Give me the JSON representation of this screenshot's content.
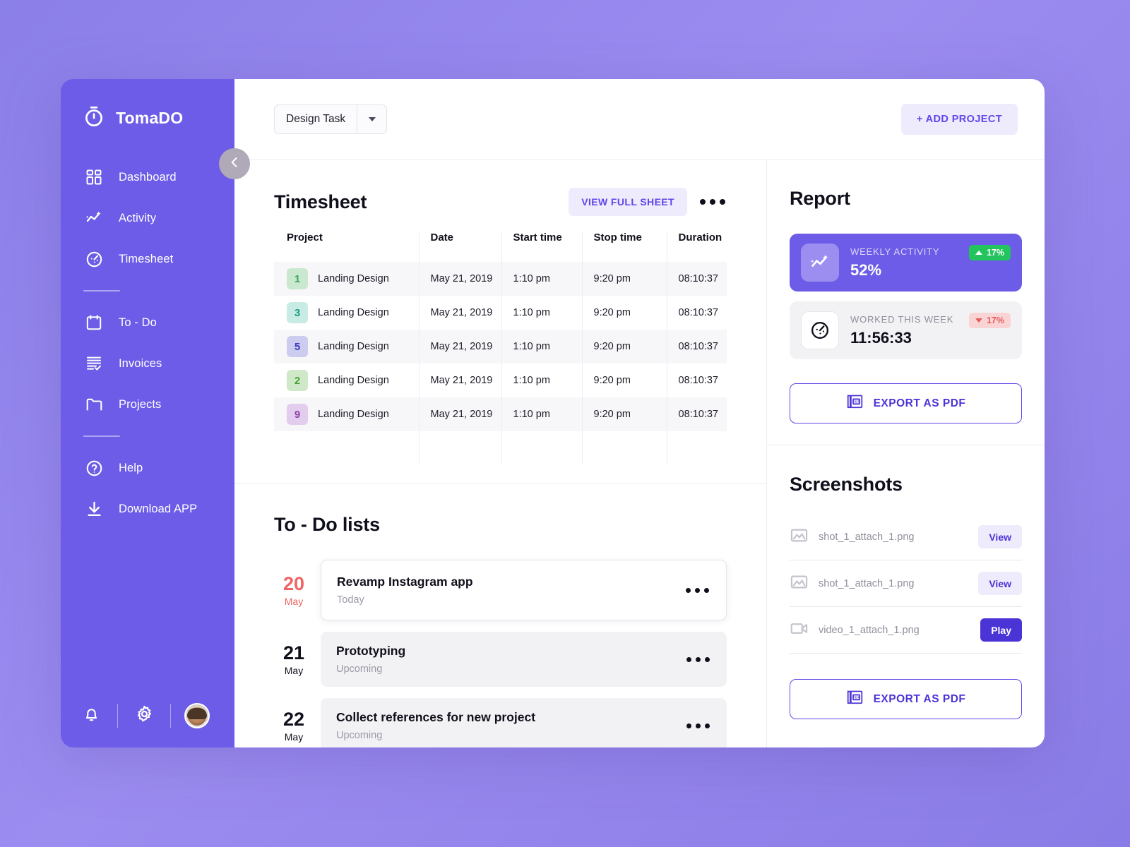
{
  "brand": {
    "name": "TomaDO",
    "logo_icon": "stopwatch-icon"
  },
  "sidebar": {
    "items": [
      {
        "label": "Dashboard",
        "icon": "grid-icon"
      },
      {
        "label": "Activity",
        "icon": "activity-sparkle-icon"
      },
      {
        "label": "Timesheet",
        "icon": "timer-icon"
      },
      {
        "label": "To - Do",
        "icon": "calendar-icon"
      },
      {
        "label": "Invoices",
        "icon": "invoice-list-icon"
      },
      {
        "label": "Projects",
        "icon": "folder-icon"
      },
      {
        "label": "Help",
        "icon": "question-circle-icon"
      },
      {
        "label": "Download APP",
        "icon": "download-icon"
      }
    ],
    "bottom": {
      "notifications_icon": "bell-icon",
      "settings_icon": "gear-icon",
      "avatar": "user-avatar"
    },
    "collapse_icon": "chevron-left-icon"
  },
  "topbar": {
    "project_select_value": "Design Task",
    "project_select_caret": "chevron-down-icon",
    "add_project_label": "+ ADD PROJECT"
  },
  "timesheet": {
    "title": "Timesheet",
    "view_full_label": "VIEW FULL SHEET",
    "more_icon": "more-horizontal-icon",
    "columns": [
      "Project",
      "Date",
      "Start time",
      "Stop time",
      "Duration"
    ],
    "rows": [
      {
        "num": "1",
        "project": "Landing Design",
        "date": "May 21, 2019",
        "start": "1:10 pm",
        "stop": "9:20 pm",
        "duration": "08:10:37",
        "badge_bg": "#c9e8cf",
        "badge_fg": "#3aa55d"
      },
      {
        "num": "3",
        "project": "Landing Design",
        "date": "May 21, 2019",
        "start": "1:10 pm",
        "stop": "9:20 pm",
        "duration": "08:10:37",
        "badge_bg": "#c8ebe4",
        "badge_fg": "#16a085"
      },
      {
        "num": "5",
        "project": "Landing Design",
        "date": "May 21, 2019",
        "start": "1:10 pm",
        "stop": "9:20 pm",
        "duration": "08:10:37",
        "badge_bg": "#ccccee",
        "badge_fg": "#3b3bc4"
      },
      {
        "num": "2",
        "project": "Landing Design",
        "date": "May 21, 2019",
        "start": "1:10 pm",
        "stop": "9:20 pm",
        "duration": "08:10:37",
        "badge_bg": "#cfe8c8",
        "badge_fg": "#4aa33a"
      },
      {
        "num": "9",
        "project": "Landing Design",
        "date": "May 21, 2019",
        "start": "1:10 pm",
        "stop": "9:20 pm",
        "duration": "08:10:37",
        "badge_bg": "#e3cdee",
        "badge_fg": "#8e44ad"
      }
    ]
  },
  "todo": {
    "title": "To - Do lists",
    "items": [
      {
        "day": "20",
        "month": "May",
        "title": "Revamp Instagram app",
        "status": "Today",
        "active": true,
        "more_icon": "more-horizontal-icon"
      },
      {
        "day": "21",
        "month": "May",
        "title": "Prototyping",
        "status": "Upcoming",
        "active": false,
        "more_icon": "more-horizontal-icon"
      },
      {
        "day": "22",
        "month": "May",
        "title": "Collect references for new project",
        "status": "Upcoming",
        "active": false,
        "more_icon": "more-horizontal-icon"
      }
    ]
  },
  "report": {
    "title": "Report",
    "cards": [
      {
        "label": "WEEKLY ACTIVITY",
        "value": "52%",
        "pill": "17%",
        "trend": "up",
        "icon": "activity-sparkle-icon"
      },
      {
        "label": "WORKED THIS WEEK",
        "value": "11:56:33",
        "pill": "17%",
        "trend": "down",
        "icon": "timer-icon"
      }
    ],
    "export_label": "EXPORT AS PDF",
    "export_icon": "pdf-icon"
  },
  "screenshots": {
    "title": "Screenshots",
    "items": [
      {
        "name": "shot_1_attach_1.png",
        "icon": "image-icon",
        "action": "View",
        "action_type": "view"
      },
      {
        "name": "shot_1_attach_1.png",
        "icon": "image-icon",
        "action": "View",
        "action_type": "view"
      },
      {
        "name": "video_1_attach_1.png",
        "icon": "video-icon",
        "action": "Play",
        "action_type": "play"
      }
    ],
    "export_label": "EXPORT AS PDF",
    "export_icon": "pdf-icon"
  },
  "colors": {
    "brand_purple": "#6c5ce7",
    "accent_violet": "#6246ea",
    "accent_deep": "#4b34d6",
    "accent_soft": "#eeebfd",
    "success_green": "#23c45e",
    "danger_red": "#e05c5c",
    "page_bg": "#9b8cf0"
  }
}
